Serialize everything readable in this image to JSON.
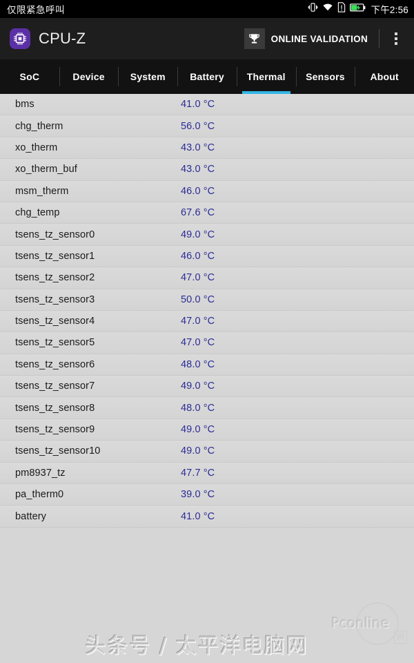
{
  "statusbar": {
    "carrier_text": "仅限紧急呼叫",
    "time": "下午2:56",
    "icons": [
      "vibrate-icon",
      "wifi-icon",
      "sim-alert-icon",
      "battery-charging-icon"
    ]
  },
  "appbar": {
    "app_icon": "cpu-chip-icon",
    "title": "CPU-Z",
    "validation_icon": "trophy-icon",
    "validation_label": "ONLINE VALIDATION",
    "overflow_icon": "more-vertical-icon"
  },
  "tabs": {
    "active_index": 4,
    "accent_color": "#34b6e4",
    "items": [
      {
        "label": "SoC"
      },
      {
        "label": "Device"
      },
      {
        "label": "System"
      },
      {
        "label": "Battery"
      },
      {
        "label": "Thermal"
      },
      {
        "label": "Sensors"
      },
      {
        "label": "About"
      }
    ]
  },
  "thermal": {
    "value_color": "#2b2b96",
    "rows": [
      {
        "name": "bms",
        "value": "41.0 °C"
      },
      {
        "name": "chg_therm",
        "value": "56.0 °C"
      },
      {
        "name": "xo_therm",
        "value": "43.0 °C"
      },
      {
        "name": "xo_therm_buf",
        "value": "43.0 °C"
      },
      {
        "name": "msm_therm",
        "value": "46.0 °C"
      },
      {
        "name": "chg_temp",
        "value": "67.6 °C"
      },
      {
        "name": "tsens_tz_sensor0",
        "value": "49.0 °C"
      },
      {
        "name": "tsens_tz_sensor1",
        "value": "46.0 °C"
      },
      {
        "name": "tsens_tz_sensor2",
        "value": "47.0 °C"
      },
      {
        "name": "tsens_tz_sensor3",
        "value": "50.0 °C"
      },
      {
        "name": "tsens_tz_sensor4",
        "value": "47.0 °C"
      },
      {
        "name": "tsens_tz_sensor5",
        "value": "47.0 °C"
      },
      {
        "name": "tsens_tz_sensor6",
        "value": "48.0 °C"
      },
      {
        "name": "tsens_tz_sensor7",
        "value": "49.0 °C"
      },
      {
        "name": "tsens_tz_sensor8",
        "value": "48.0 °C"
      },
      {
        "name": "tsens_tz_sensor9",
        "value": "49.0 °C"
      },
      {
        "name": "tsens_tz_sensor10",
        "value": "49.0 °C"
      },
      {
        "name": "pm8937_tz",
        "value": "47.7 °C"
      },
      {
        "name": "pa_therm0",
        "value": "39.0 °C"
      },
      {
        "name": "battery",
        "value": "41.0 °C"
      }
    ]
  },
  "watermark": {
    "text": "头条号 / 太平洋电脑网",
    "logo_text": "Pconline",
    "logo_badge": "网"
  }
}
